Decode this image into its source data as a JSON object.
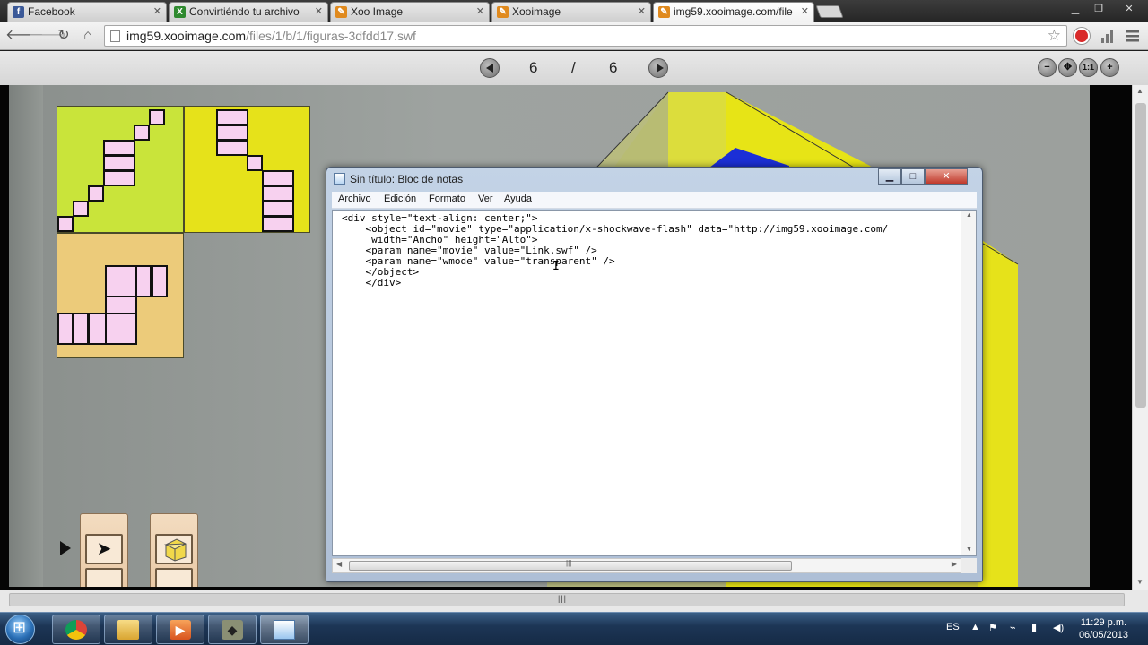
{
  "browser": {
    "tabs": [
      {
        "title": "Facebook",
        "icon": "facebook-icon",
        "color": "#3b5998"
      },
      {
        "title": "Convirtiéndo tu archivo",
        "icon": "file-convert-icon",
        "color": "#2f8a2f"
      },
      {
        "title": "Xoo Image",
        "icon": "xooimage-icon",
        "color": "#e08a1e"
      },
      {
        "title": "Xooimage",
        "icon": "xooimage-icon",
        "color": "#e08a1e"
      },
      {
        "title": "img59.xooimage.com/file",
        "icon": "xooimage-icon",
        "color": "#e08a1e"
      }
    ],
    "url": {
      "host": "img59.xooimage.com",
      "path": "/files/1/b/1/figuras-3dfdd17.swf"
    }
  },
  "viewer": {
    "current_page": "6",
    "separator": "/",
    "total_pages": "6",
    "actual_size_label": "1:1"
  },
  "notepad": {
    "title": "Sin título: Bloc de notas",
    "menu": [
      "Archivo",
      "Edición",
      "Formato",
      "Ver",
      "Ayuda"
    ],
    "lines": [
      "<div style=\"text-align: center;\">",
      "    <object id=\"movie\" type=\"application/x-shockwave-flash\" data=\"http://img59.xooimage.com/",
      "     width=\"Ancho\" height=\"Alto\">",
      "    <param name=\"movie\" value=\"Link.swf\" />",
      "    <param name=\"wmode\" value=\"transparent\" />",
      "    </object>",
      "    </div>"
    ]
  },
  "taskbar": {
    "language": "ES",
    "time": "11:29 p.m.",
    "date": "06/05/2013"
  },
  "colors": {
    "panel_lime": "#c9e43a",
    "panel_yellow": "#e6e21a",
    "panel_tan": "#eccb7a",
    "square_pink": "#f7d1ef",
    "shape_blue": "#1b2fd6"
  }
}
